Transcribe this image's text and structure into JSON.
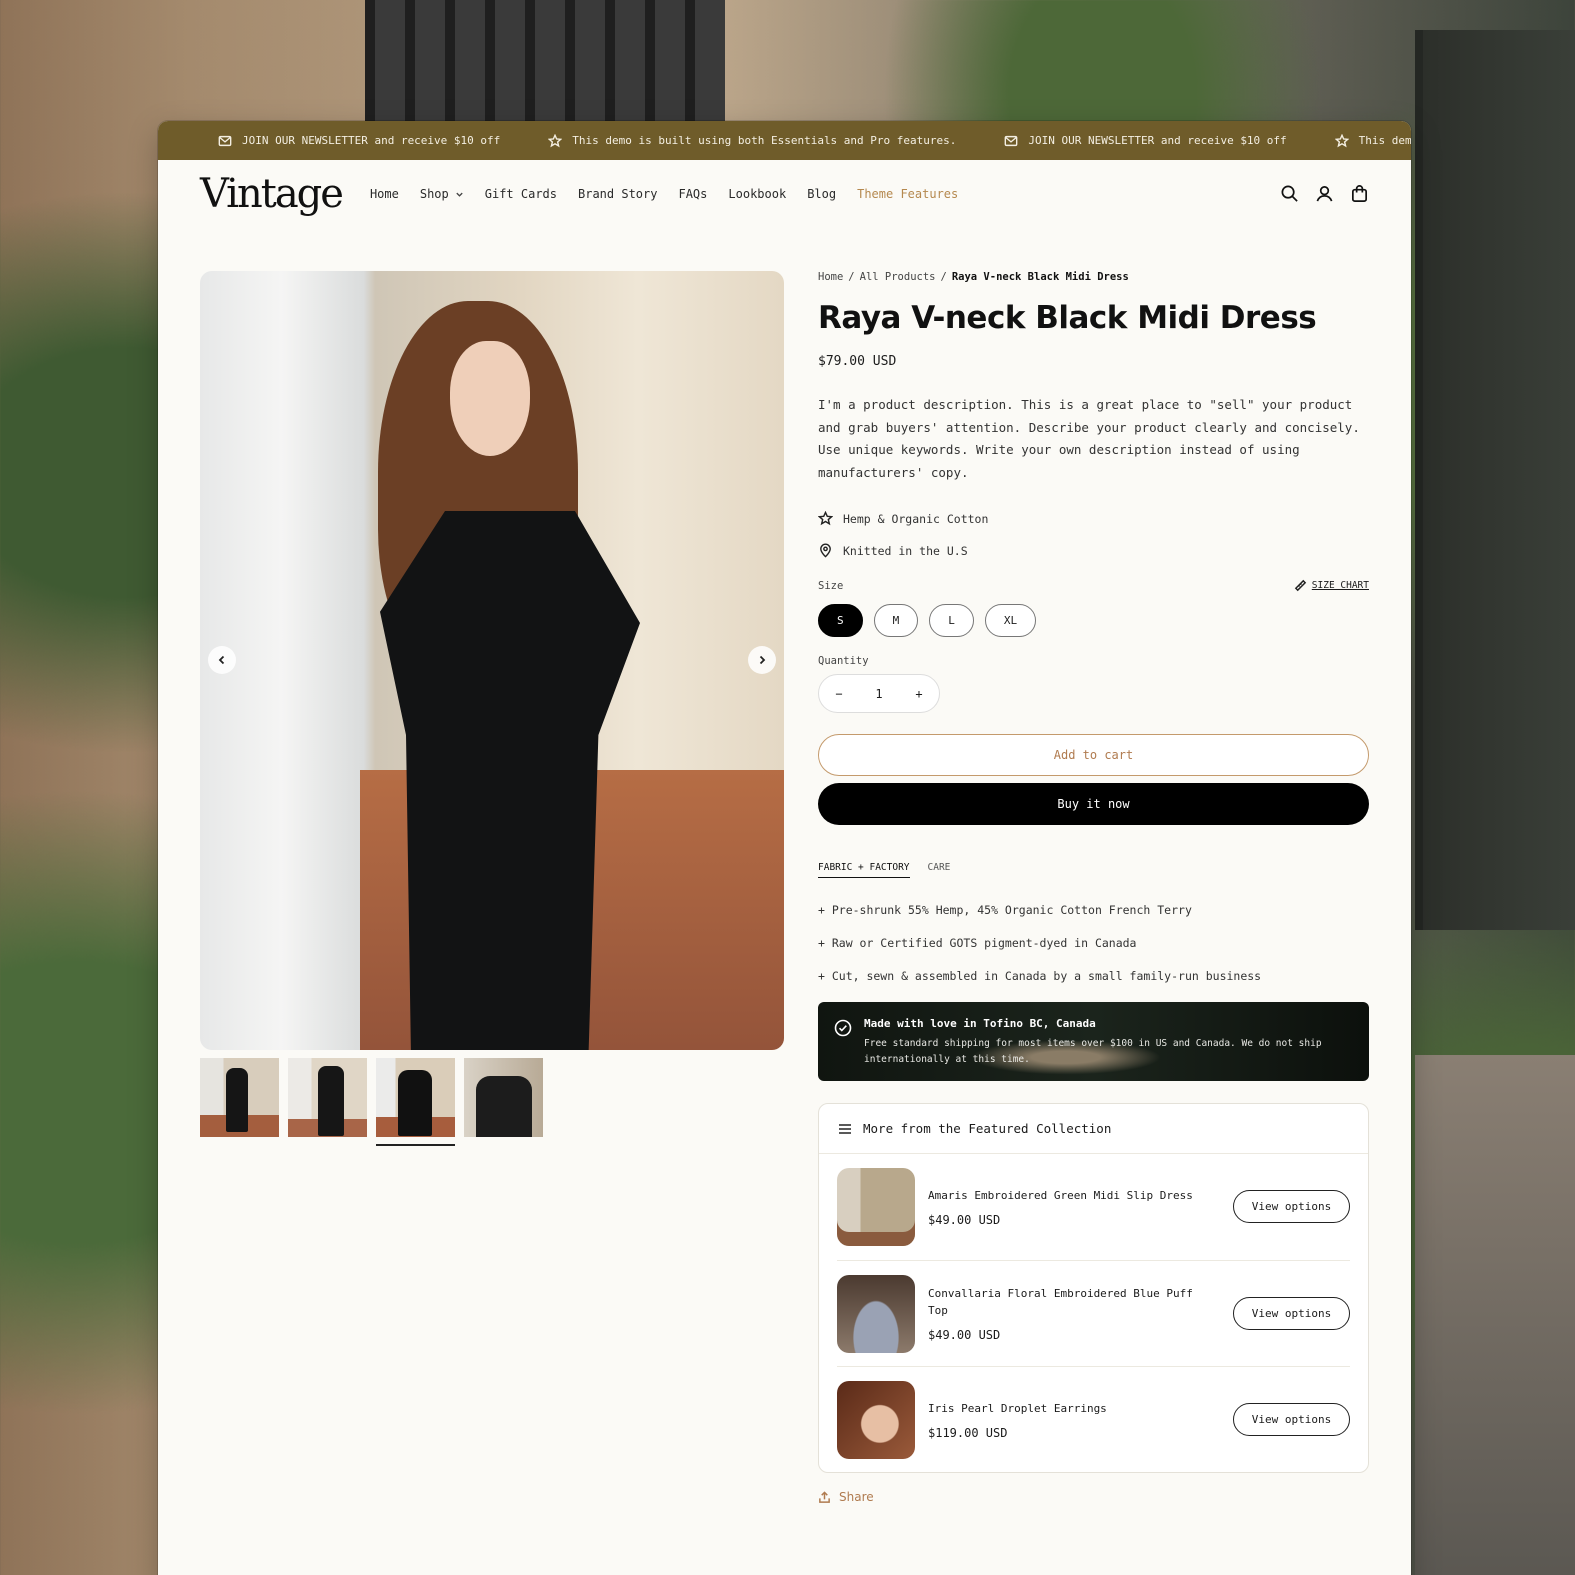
{
  "announcement": {
    "items": [
      {
        "icon": "envelope-icon",
        "text": "JOIN OUR NEWSLETTER and receive $10 off"
      },
      {
        "icon": "star-icon",
        "text": "This demo is built using both Essentials and Pro features."
      },
      {
        "icon": "envelope-icon",
        "text": "JOIN OUR NEWSLETTER and receive $10 off"
      },
      {
        "icon": "star-icon",
        "text": "This demo is built using b"
      }
    ]
  },
  "header": {
    "logo": "Vintage",
    "nav": [
      {
        "label": "Home"
      },
      {
        "label": "Shop",
        "dropdown": true
      },
      {
        "label": "Gift Cards"
      },
      {
        "label": "Brand Story"
      },
      {
        "label": "FAQs"
      },
      {
        "label": "Lookbook"
      },
      {
        "label": "Blog"
      },
      {
        "label": "Theme Features",
        "accent": true
      }
    ],
    "icons": [
      "search-icon",
      "account-icon",
      "cart-icon"
    ]
  },
  "breadcrumb": {
    "home": "Home",
    "separator": "/",
    "collection": "All Products",
    "current": "Raya V-neck Black Midi Dress"
  },
  "product": {
    "title": "Raya V-neck Black Midi Dress",
    "price": "$79.00 USD",
    "description": "I'm a product description. This is a great place to \"sell\" your product and grab buyers' attention. Describe your product clearly and concisely. Use unique keywords. Write your own description instead of using manufacturers' copy.",
    "features": [
      {
        "icon": "star-icon",
        "text": "Hemp & Organic Cotton"
      },
      {
        "icon": "location-pin-icon",
        "text": "Knitted in the U.S"
      }
    ],
    "size_label": "Size",
    "size_chart_label": "SIZE CHART",
    "sizes": [
      "S",
      "M",
      "L",
      "XL"
    ],
    "selected_size": "S",
    "quantity_label": "Quantity",
    "quantity": "1",
    "qty_minus": "−",
    "qty_plus": "+",
    "add_to_cart": "Add to cart",
    "buy_now": "Buy it now",
    "tabs": [
      "FABRIC + FACTORY",
      "CARE"
    ],
    "active_tab": "FABRIC + FACTORY",
    "bullets": [
      "+ Pre-shrunk 55% Hemp, 45% Organic Cotton French Terry",
      "+ Raw or Certified GOTS pigment-dyed in Canada",
      "+ Cut, sewn & assembled in Canada by a small family-run business"
    ],
    "image_count": 4,
    "active_image": 3
  },
  "banner": {
    "title": "Made with love in Tofino BC, Canada",
    "text": "Free standard shipping for most items over $100 in US and Canada. We do not ship internationally at this time."
  },
  "featured": {
    "heading": "More from the Featured Collection",
    "button_label": "View options",
    "items": [
      {
        "name": "Amaris Embroidered Green Midi Slip Dress",
        "price": "$49.00 USD"
      },
      {
        "name": "Convallaria Floral Embroidered Blue Puff Top",
        "price": "$49.00 USD"
      },
      {
        "name": "Iris Pearl Droplet Earrings",
        "price": "$119.00 USD"
      }
    ]
  },
  "share_label": "Share",
  "colors": {
    "announcement_bg": "#6f5c2a",
    "accent": "#b07b4f",
    "primary_button": "#000000",
    "page_bg": "#fbfaf6"
  }
}
